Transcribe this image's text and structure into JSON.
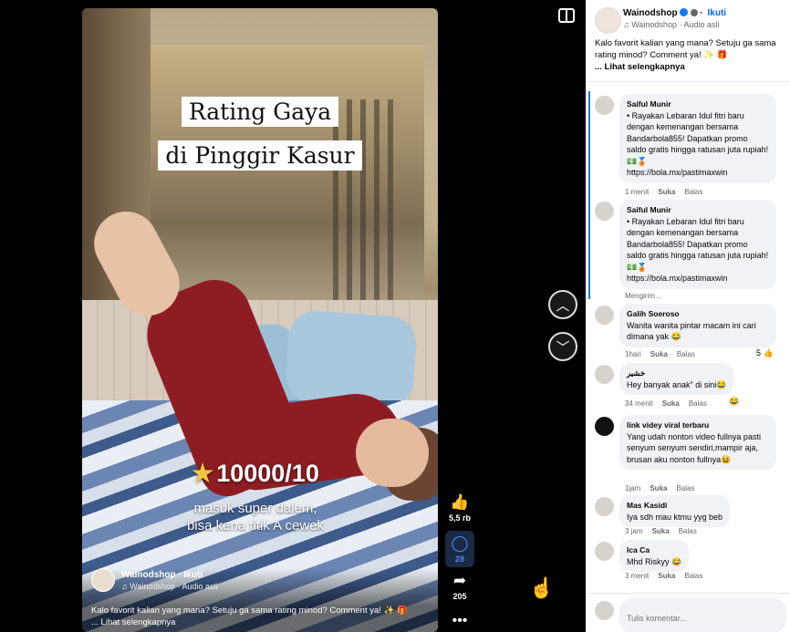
{
  "video": {
    "title_line1": "Rating Gaya",
    "title_line2": "di Pinggir Kasur",
    "rating": "10000/10",
    "sub_line1": "masuk super dalem,",
    "sub_line2": "bisa kena titik A cewek",
    "author": "Wainodshop",
    "follow": "· Ikuti",
    "audio": "♫ Wainodshop · Audio asli",
    "caption": "Kalo favorit kalian yang mana? Setuju ga sama rating minod? Comment ya! ✨ 🎁",
    "caption_more": "... Lihat selengkapnya"
  },
  "rail": {
    "like_icon": "👍",
    "like_count": "5,5 rb",
    "comment_icon": "◯",
    "comment_count": "28",
    "share_icon": "➦",
    "share_count": "205",
    "more_icon": "•••"
  },
  "nav": {
    "up_icon": "︿",
    "down_icon": "﹀"
  },
  "panel": {
    "author": "Wainodshop",
    "follow": "Ikuti",
    "audio": "♫ Wainodshop · Audio asli",
    "caption": "Kalo favorit kalian yang mana? Setuju ga sama rating minod? Comment ya! ✨ 🎁",
    "more": "... Lihat selengkapnya"
  },
  "comments": [
    {
      "name": "Saiful Munir",
      "text": "• Rayakan Lebaran Idul fitri baru dengan kemenangan bersama Bandarbola855! Dapatkan promo saldo gratis hingga ratusan juta rupiah!💵🥉",
      "link": "https://bola.mx/pastimaxwin",
      "time": "1 menit",
      "like": "Suka",
      "reply": "Balas"
    },
    {
      "name": "Saiful Munir",
      "text": "• Rayakan Lebaran Idul fitri baru dengan kemenangan bersama Bandarbola855! Dapatkan promo saldo gratis hingga ratusan juta rupiah!💵🥉",
      "link": "https://bola.mx/pastimaxwin",
      "status": "Mengirim..."
    },
    {
      "name": "Galih Soeroso",
      "text": "Wanita wanita pintar macam ini cari dimana yak 😂",
      "time": "1hari",
      "like": "Suka",
      "reply": "Balas",
      "reactions": "5 👍"
    },
    {
      "name": "خشير",
      "text": "Hey banyak anak\" di sini😂",
      "time": "34 menit",
      "like": "Suka",
      "reply": "Balas",
      "reactions": "😂"
    },
    {
      "name": "link videy viral terbaru",
      "text": "Yang udah nonton video fullnya pasti senyum senyum sendiri,mampir aja, brusan aku nonton fullnya😆",
      "time": "1jam",
      "like": "Suka",
      "reply": "Balas"
    },
    {
      "name": "Mas Kasidi",
      "text": "Iya sdh mau ktmu yyg beb",
      "time": "3 jam",
      "like": "Suka",
      "reply": "Balas"
    },
    {
      "name": "Ica Ca",
      "text": "Mhd Riskyy 😂",
      "time": "3 menit",
      "like": "Suka",
      "reply": "Balas"
    }
  ],
  "footer": {
    "placeholder": "Tulis komentar..."
  }
}
